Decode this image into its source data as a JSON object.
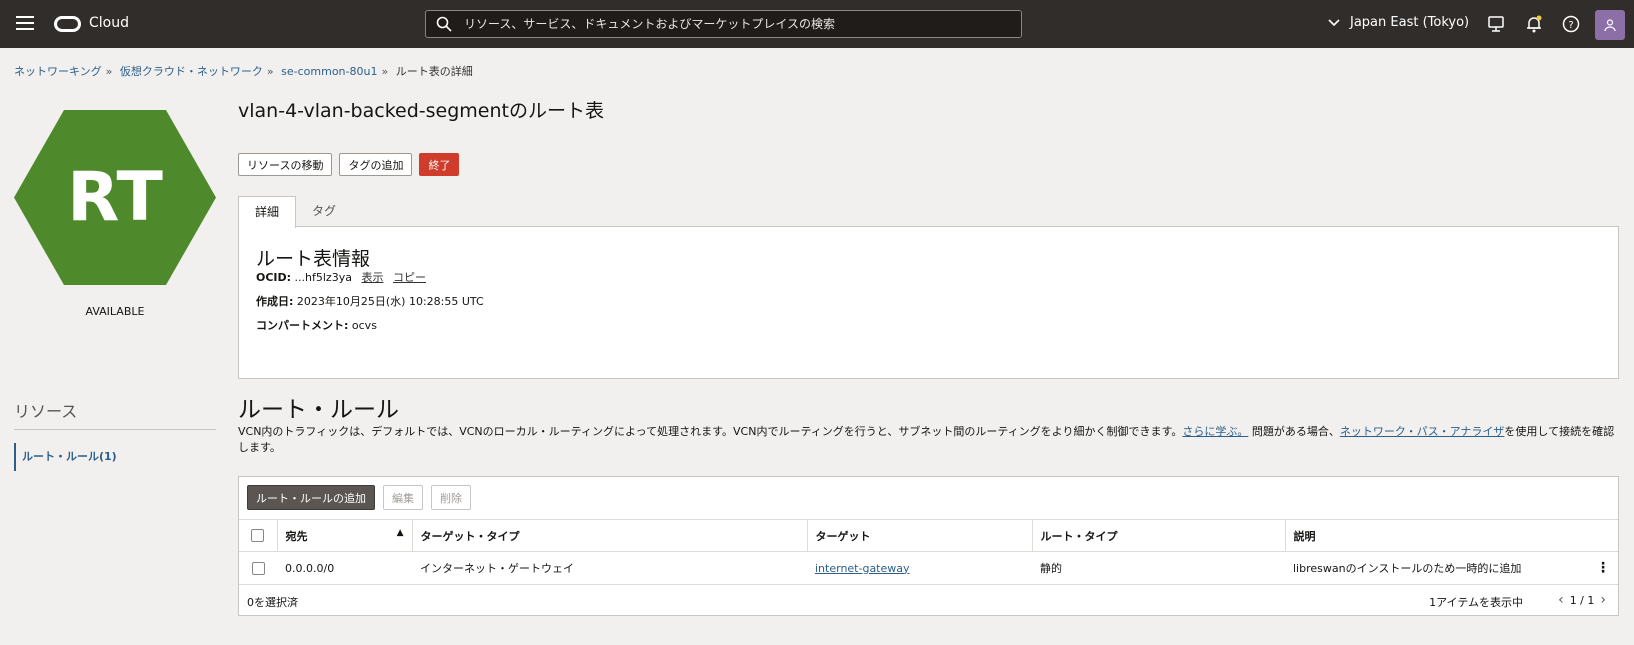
{
  "topbar": {
    "brand": "Cloud",
    "search_placeholder": "リソース、サービス、ドキュメントおよびマーケットプレイスの検索",
    "region": "Japan East (Tokyo)"
  },
  "breadcrumb": {
    "items": [
      "ネットワーキング",
      "仮想クラウド・ネットワーク",
      "se-common-80u1"
    ],
    "current": "ルート表の詳細"
  },
  "resource": {
    "icon_text": "RT",
    "icon_color": "#4e8a2b",
    "status": "AVAILABLE"
  },
  "sidebar": {
    "title": "リソース",
    "items": [
      {
        "label": "ルート・ルール(1)"
      }
    ]
  },
  "page": {
    "title": "vlan-4-vlan-backed-segmentのルート表",
    "actions": {
      "move": "リソースの移動",
      "add_tag": "タグの追加",
      "terminate": "終了"
    },
    "tabs": [
      "詳細",
      "タグ"
    ]
  },
  "details": {
    "heading": "ルート表情報",
    "ocid_label": "OCID:",
    "ocid_value": "...hf5lz3ya",
    "ocid_show": "表示",
    "ocid_copy": "コピー",
    "created_label": "作成日:",
    "created_value": "2023年10月25日(水) 10:28:55 UTC",
    "compartment_label": "コンパートメント:",
    "compartment_value": "ocvs"
  },
  "rules": {
    "title": "ルート・ルール",
    "desc_part1": "VCN内のトラフィックは、デフォルトでは、VCNのローカル・ルーティングによって処理されます。VCN内でルーティングを行うと、サブネット間のルーティングをより細かく制御できます。",
    "learn_more": "さらに学ぶ。",
    "desc_part2": " 問題がある場合、",
    "analyzer_link": "ネットワーク・パス・アナライザ",
    "desc_part3": "を使用して接続を確認します。",
    "add_button": "ルート・ルールの追加",
    "edit_button": "編集",
    "delete_button": "削除",
    "columns": [
      "宛先",
      "ターゲット・タイプ",
      "ターゲット",
      "ルート・タイプ",
      "説明"
    ],
    "sort_indicator": "▲",
    "rows": [
      {
        "destination": "0.0.0.0/0",
        "target_type": "インターネット・ゲートウェイ",
        "target": "internet-gateway",
        "route_type": "静的",
        "description": "libreswanのインストールのため一時的に追加"
      }
    ],
    "selected": "0を選択済",
    "showing": "1アイテムを表示中",
    "page": "1 / 1"
  }
}
